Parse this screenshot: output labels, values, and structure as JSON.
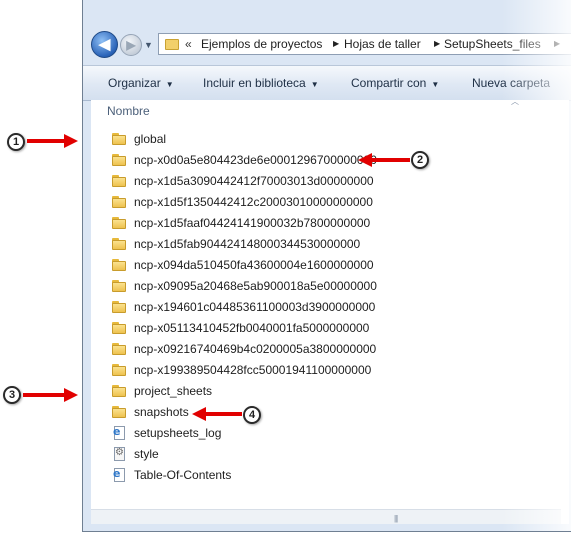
{
  "address_bar": {
    "overflow_glyph": "«",
    "crumbs": [
      "Ejemplos de proyectos",
      "Hojas de taller",
      "SetupSheets_files"
    ],
    "separator_glyph": "▶"
  },
  "toolbar": {
    "organize": "Organizar",
    "include_in_library": "Incluir en biblioteca",
    "share_with": "Compartir con",
    "new_folder": "Nueva carpeta"
  },
  "column_header": {
    "name": "Nombre"
  },
  "files": [
    {
      "name": "global",
      "icon": "folder-icon"
    },
    {
      "name": "ncp-x0d0a5e804423de6e0001296700000000",
      "icon": "folder-icon"
    },
    {
      "name": "ncp-x1d5a3090442412f70003013d00000000",
      "icon": "folder-icon"
    },
    {
      "name": "ncp-x1d5f1350442412c20003010000000000",
      "icon": "folder-icon"
    },
    {
      "name": "ncp-x1d5faaf04424141900032b7800000000",
      "icon": "folder-icon"
    },
    {
      "name": "ncp-x1d5fab904424148000344530000000",
      "icon": "folder-icon"
    },
    {
      "name": "ncp-x094da510450fa43600004e1600000000",
      "icon": "folder-icon"
    },
    {
      "name": "ncp-x09095a20468e5ab900018a5e00000000",
      "icon": "folder-icon"
    },
    {
      "name": "ncp-x194601c04485361100003d3900000000",
      "icon": "folder-icon"
    },
    {
      "name": "ncp-x05113410452fb0040001fa5000000000",
      "icon": "folder-icon"
    },
    {
      "name": "ncp-x09216740469b4c0200005a3800000000",
      "icon": "folder-icon"
    },
    {
      "name": "ncp-x199389504428fcc50001941100000000",
      "icon": "folder-icon"
    },
    {
      "name": "project_sheets",
      "icon": "folder-icon"
    },
    {
      "name": "snapshots",
      "icon": "folder-icon"
    },
    {
      "name": "setupsheets_log",
      "icon": "html-document-icon"
    },
    {
      "name": "style",
      "icon": "stylesheet-icon"
    },
    {
      "name": "Table-Of-Contents",
      "icon": "html-document-icon"
    }
  ],
  "callouts": [
    "1",
    "2",
    "3",
    "4"
  ],
  "colors": {
    "arrow": "#e10000",
    "toolbar_text": "#1e2f45",
    "header_text": "#4c607a"
  }
}
